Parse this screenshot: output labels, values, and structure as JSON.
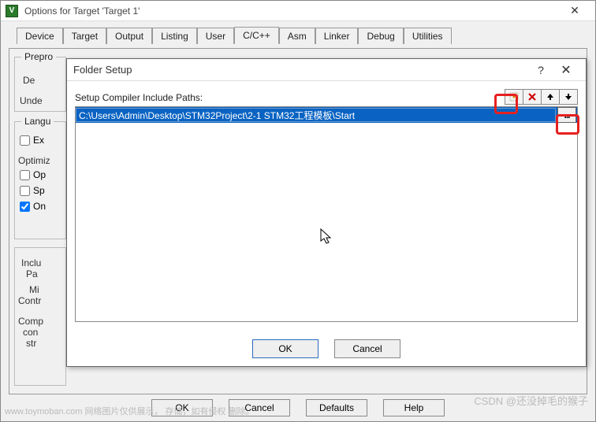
{
  "outer": {
    "title": "Options for Target 'Target 1'",
    "app_icon_letter": "V",
    "tabs": [
      "Device",
      "Target",
      "Output",
      "Listing",
      "User",
      "C/C++",
      "Asm",
      "Linker",
      "Debug",
      "Utilities"
    ],
    "active_tab_index": 5,
    "left": {
      "prepro": "Prepro",
      "de": "De",
      "under": "Unde",
      "langu": "Langu",
      "ex": "Ex",
      "optimiz": "Optimiz",
      "op": "Op",
      "sp": "Sp",
      "on": "On",
      "inclu": "Inclu",
      "pa": "Pa",
      "mi": "Mi",
      "contr": "Contr",
      "comp": "Comp",
      "con": "con",
      "str": "str"
    },
    "buttons": {
      "ok": "OK",
      "cancel": "Cancel",
      "defaults": "Defaults",
      "help": "Help"
    }
  },
  "dlg": {
    "title": "Folder Setup",
    "label": "Setup Compiler Include Paths:",
    "path_value": "C:\\Users\\Admin\\Desktop\\STM32Project\\2-1 STM32工程模板\\Start",
    "browse": "...",
    "buttons": {
      "ok": "OK",
      "cancel": "Cancel"
    },
    "tool_icons": {
      "new": "new-icon",
      "delete": "delete-icon",
      "up": "arrow-up-icon",
      "down": "arrow-down-icon"
    }
  },
  "watermarks": {
    "left": "www.toymoban.com  网络图片仅供展示，              存储，如有侵权            删除。",
    "right": "CSDN @还没掉毛的猴子"
  }
}
